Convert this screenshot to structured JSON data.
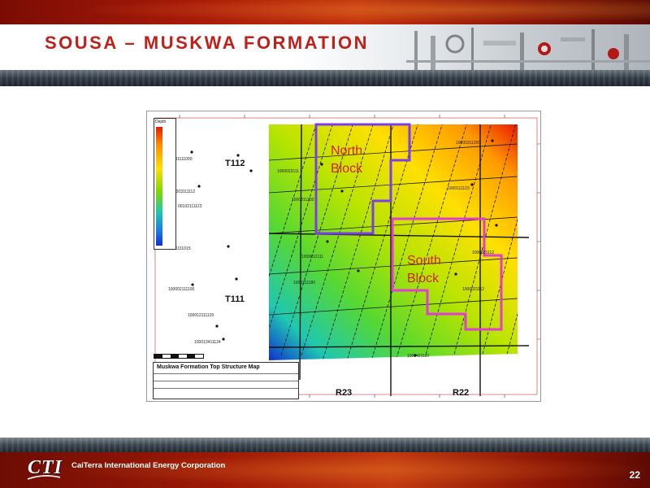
{
  "header": {
    "title": "SOUSA – MUSKWA FORMATION"
  },
  "map": {
    "title": "Muskwa Formation Top Structure Map",
    "legend_label": "Depth",
    "blocks": [
      {
        "name": "North\nBlock",
        "color": "#7a3df0"
      },
      {
        "name": "South\nBlock",
        "color": "#e23bd6"
      }
    ],
    "label_color": "#d0231c",
    "townships": [
      "T112",
      "T111"
    ],
    "ranges": [
      "R23",
      "R22"
    ],
    "colors": {
      "map_red": "#e81a00",
      "map_yellow": "#ffe000",
      "map_green": "#7cd800",
      "map_cyan": "#1ec8b0",
      "map_blue": "#1030d0"
    }
  },
  "footer": {
    "logo": "CTI",
    "company": "CaiTerra International Energy Corporation",
    "page_number": "22"
  },
  "theme": {
    "accent_red": "#c0201a",
    "bar_red": "#a81a08",
    "bar_grey": "#2f3a44"
  }
}
